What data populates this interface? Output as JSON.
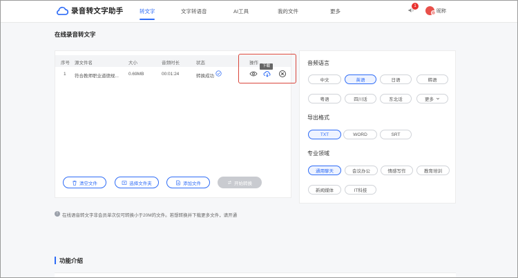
{
  "app": {
    "title": "录音转文字助手"
  },
  "nav": {
    "items": [
      {
        "label": "转文字",
        "active": true
      },
      {
        "label": "文字转语音",
        "active": false
      },
      {
        "label": "AI工具",
        "active": false
      },
      {
        "label": "我的文件",
        "active": false
      },
      {
        "label": "更多",
        "active": false
      }
    ]
  },
  "user": {
    "notification_count": "1",
    "nickname": "昵称"
  },
  "page": {
    "title": "在线录音转文字"
  },
  "table": {
    "headers": {
      "index": "序号",
      "filename": "源文件名",
      "size": "大小",
      "duration": "音频时长",
      "status": "状态",
      "actions": "操作"
    },
    "rows": [
      {
        "index": "1",
        "filename": "符合教师职业道德规...",
        "size": "0.69MB",
        "duration": "00:01:24",
        "status": "转换成功"
      }
    ],
    "tooltip": "下载"
  },
  "buttons": {
    "clear": "清空文件",
    "select_folder": "选择文件夹",
    "add_file": "添加文件",
    "start": "开始转换"
  },
  "options": {
    "language": {
      "title": "音频语言",
      "items": [
        "中文",
        "英语",
        "日语",
        "韩语",
        "粤语",
        "四川话",
        "东北话",
        "更多"
      ],
      "selected": "英语"
    },
    "format": {
      "title": "导出格式",
      "items": [
        "TXT",
        "WORD",
        "SRT"
      ],
      "selected": "TXT"
    },
    "domain": {
      "title": "专业领域",
      "items": [
        "通用聊天",
        "会议办公",
        "情感写作",
        "教育培训",
        "新闻媒体",
        "IT科技"
      ],
      "selected": "通用聊天"
    }
  },
  "notice": {
    "text": "在线语音转文字非会员单次仅可转换小于20M的文件。若想转换并下载更多文件，请开通"
  },
  "section": {
    "title": "功能介绍"
  },
  "colors": {
    "accent": "#2d6bf6",
    "highlight": "#d9453a",
    "badge": "#e8322f"
  }
}
